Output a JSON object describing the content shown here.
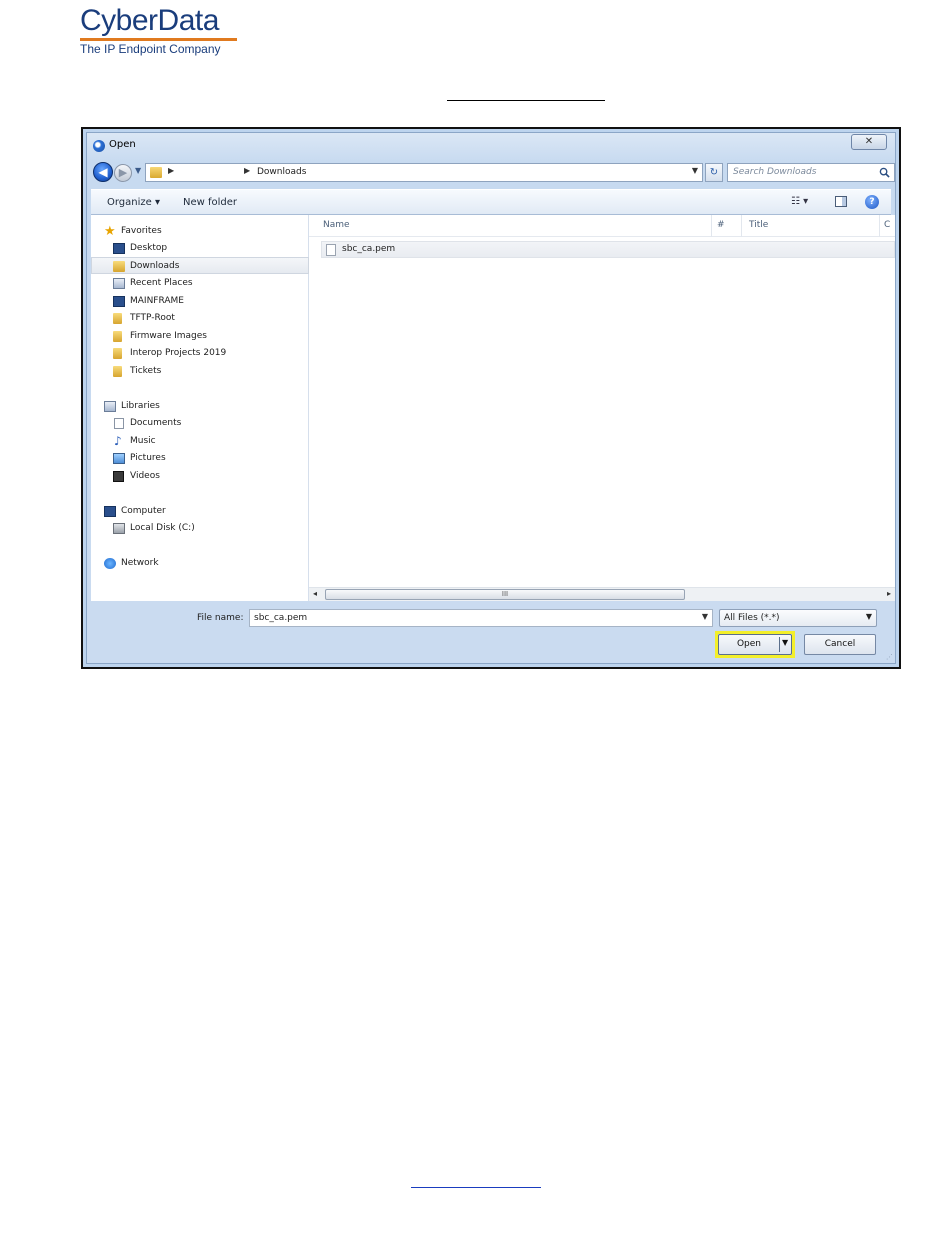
{
  "logo": {
    "brand": "CyberData",
    "tagline": "The IP Endpoint Company"
  },
  "dialog": {
    "title": "Open",
    "close_glyph": "✕",
    "address": {
      "current": "Downloads",
      "search_placeholder": "Search Downloads"
    },
    "toolbar": {
      "organize": "Organize ▾",
      "new_folder": "New folder",
      "views_glyph": "☷ ▾",
      "help_glyph": "?"
    },
    "nav": {
      "favorites": {
        "header": "Favorites",
        "items": [
          "Desktop",
          "Downloads",
          "Recent Places",
          "MAINFRAME",
          "TFTP-Root",
          "Firmware Images",
          "Interop Projects 2019",
          "Tickets"
        ]
      },
      "libraries": {
        "header": "Libraries",
        "items": [
          "Documents",
          "Music",
          "Pictures",
          "Videos"
        ]
      },
      "computer": {
        "header": "Computer",
        "items": [
          "Local Disk (C:)"
        ]
      },
      "network": {
        "header": "Network"
      }
    },
    "columns": {
      "name": "Name",
      "number": "#",
      "title": "Title",
      "contributing": "C"
    },
    "files": [
      "sbc_ca.pem"
    ],
    "scroll_thumb_glyph": "III",
    "filename": {
      "label": "File name:",
      "value": "sbc_ca.pem"
    },
    "filetype": {
      "value": "All Files (*.*)"
    },
    "buttons": {
      "open": "Open",
      "cancel": "Cancel"
    }
  },
  "colors": {
    "brand_blue": "#1a3d7c",
    "brand_orange": "#e07a1f",
    "highlight": "#f3ef2a"
  }
}
